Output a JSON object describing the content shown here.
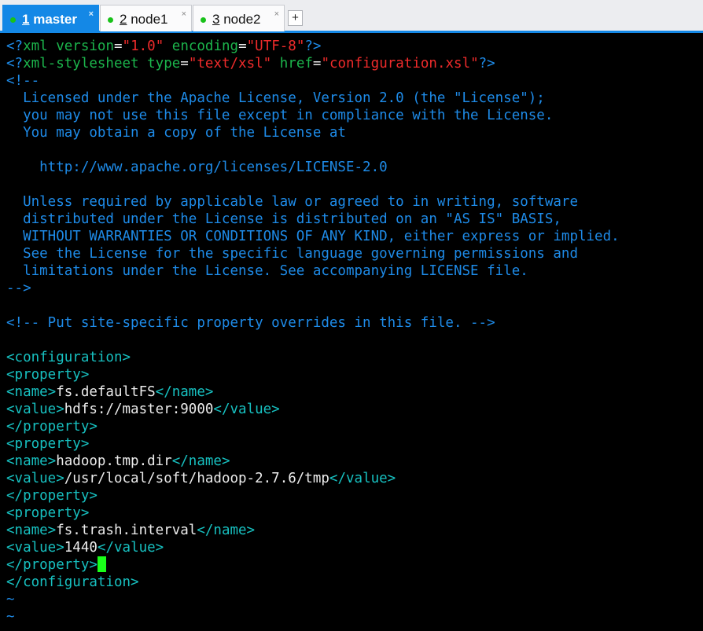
{
  "tabs": [
    {
      "num": "1",
      "name": "master"
    },
    {
      "num": "2",
      "name": "node1"
    },
    {
      "num": "3",
      "name": "node2"
    }
  ],
  "new_tab_label": "+",
  "close_glyph": "×",
  "editor": {
    "xml_decl": {
      "open": "<?",
      "tag": "xml",
      "attr1": "version",
      "eq": "=",
      "val1": "\"1.0\"",
      "attr2": "encoding",
      "val2": "\"UTF-8\"",
      "close": "?>"
    },
    "stylesheet": {
      "open": "<?",
      "tag": "xml-stylesheet",
      "attr1": "type",
      "eq": "=",
      "val1": "\"text/xsl\"",
      "attr2": "href",
      "val2": "\"configuration.xsl\"",
      "close": "?>"
    },
    "comment_open": "<!--",
    "license_lines": [
      "  Licensed under the Apache License, Version 2.0 (the \"License\");",
      "  you may not use this file except in compliance with the License.",
      "  You may obtain a copy of the License at",
      "",
      "    http://www.apache.org/licenses/LICENSE-2.0",
      "",
      "  Unless required by applicable law or agreed to in writing, software",
      "  distributed under the License is distributed on an \"AS IS\" BASIS,",
      "  WITHOUT WARRANTIES OR CONDITIONS OF ANY KIND, either express or implied.",
      "  See the License for the specific language governing permissions and",
      "  limitations under the License. See accompanying LICENSE file."
    ],
    "comment_close": "-->",
    "site_comment": "<!-- Put site-specific property overrides in this file. -->",
    "configuration_open": "<configuration>",
    "configuration_close": "</configuration>",
    "property_open": "<property>",
    "property_close": "</property>",
    "name_open": "<name>",
    "name_close": "</name>",
    "value_open": "<value>",
    "value_close": "</value>",
    "properties": [
      {
        "name": "fs.defaultFS",
        "value": "hdfs://master:9000"
      },
      {
        "name": "hadoop.tmp.dir",
        "value": "/usr/local/soft/hadoop-2.7.6/tmp"
      },
      {
        "name": "fs.trash.interval",
        "value": "1440"
      }
    ],
    "tilde": "~",
    "colors": {
      "tag": "#17c0c0",
      "comment": "#1e8be8",
      "attr": "#1cb54c",
      "string": "#ef2b2b",
      "text": "#ececec",
      "cursor": "#19ff19",
      "tab_active": "#1488e6",
      "tab_dot": "#19c21a"
    }
  }
}
